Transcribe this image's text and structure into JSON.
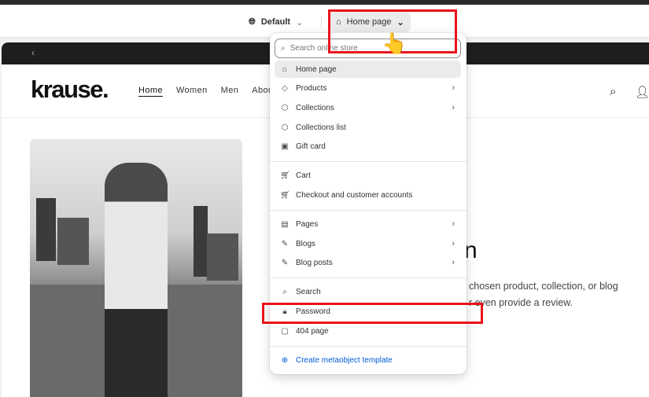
{
  "topbar": {
    "theme_label": "Default",
    "template_label": "Home page"
  },
  "store": {
    "logo": "krause.",
    "nav": [
      "Home",
      "Women",
      "Men",
      "About"
    ],
    "hero_heading_fragment": "n",
    "hero_text_line1": "chosen product, collection, or blog",
    "hero_text_line2": "r even provide a review."
  },
  "menu": {
    "search_placeholder": "Search online store",
    "items": [
      {
        "label": "Home page",
        "icon": "home-icon",
        "selected": true
      },
      {
        "label": "Products",
        "icon": "tag-icon",
        "submenu": true
      },
      {
        "label": "Collections",
        "icon": "collections-icon",
        "submenu": true
      },
      {
        "label": "Collections list",
        "icon": "collections-list-icon"
      },
      {
        "label": "Gift card",
        "icon": "gift-card-icon"
      },
      {
        "label": "Cart",
        "icon": "cart-icon"
      },
      {
        "label": "Checkout and customer accounts",
        "icon": "checkout-icon"
      },
      {
        "label": "Pages",
        "icon": "page-icon",
        "submenu": true
      },
      {
        "label": "Blogs",
        "icon": "blog-icon",
        "submenu": true
      },
      {
        "label": "Blog posts",
        "icon": "blog-post-icon",
        "submenu": true
      },
      {
        "label": "Search",
        "icon": "search-icon"
      },
      {
        "label": "Password",
        "icon": "lock-icon"
      },
      {
        "label": "404 page",
        "icon": "404-icon"
      }
    ],
    "create_label": "Create metaobject template"
  },
  "colors": {
    "highlight": "#e8141c",
    "link": "#005bd3"
  }
}
